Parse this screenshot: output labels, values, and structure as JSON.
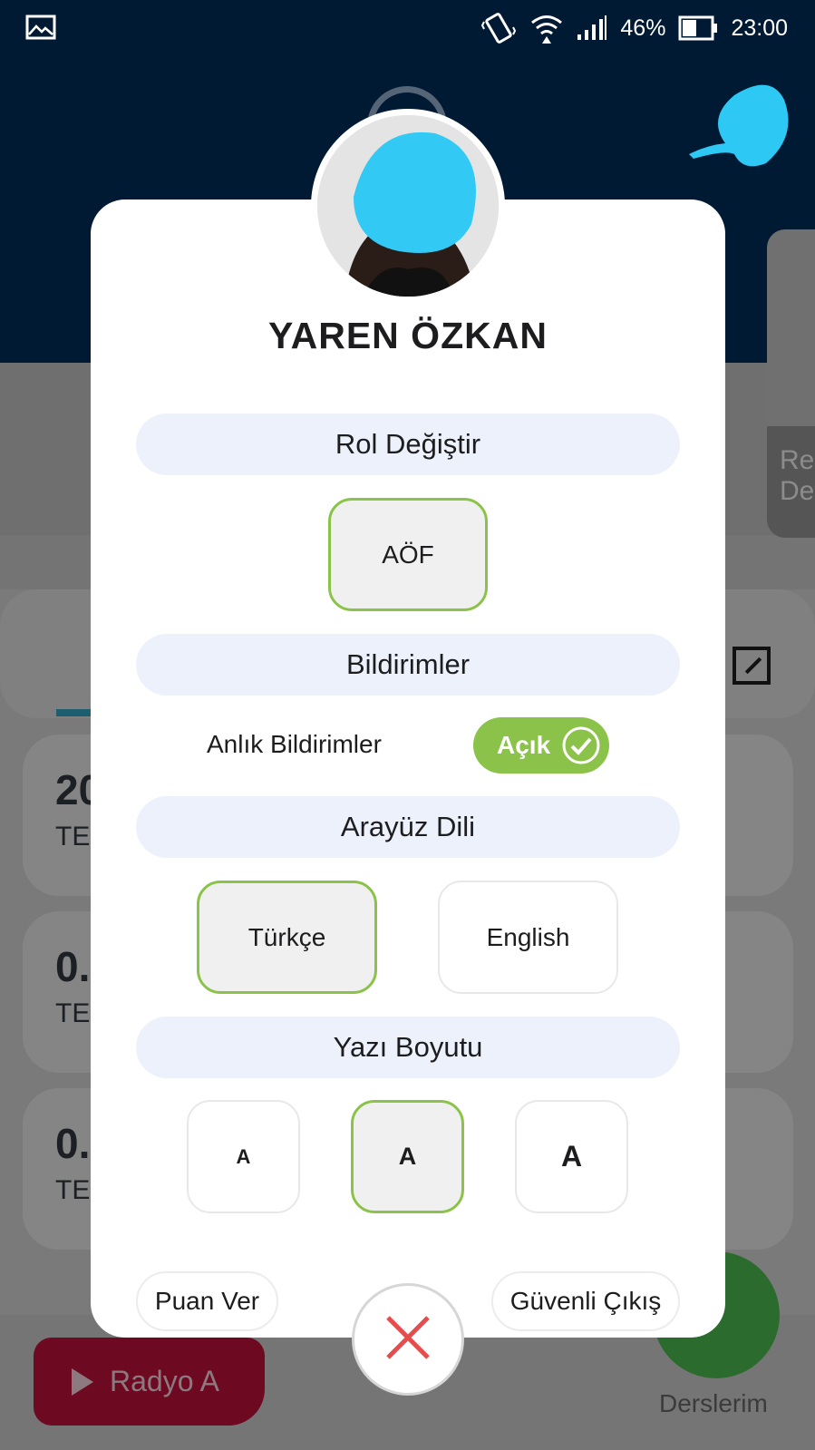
{
  "status_bar": {
    "battery": "46%",
    "time": "23:00",
    "icons": [
      "image-icon",
      "vibrate-icon",
      "wifi-icon",
      "signal-icon",
      "battery-icon"
    ]
  },
  "background": {
    "side_card_text": "Re\nDe",
    "rows": [
      {
        "big": "20",
        "small": "TE"
      },
      {
        "big": "0.",
        "small": "TE"
      },
      {
        "big": "0.",
        "small": "TE"
      }
    ],
    "radio_button": "Radyo A",
    "derslerim_label": "Derslerim"
  },
  "profile": {
    "name": "YAREN ÖZKAN"
  },
  "sections": {
    "role": {
      "title": "Rol Değiştir",
      "options": [
        {
          "label": "AÖF",
          "selected": true
        }
      ]
    },
    "notifications": {
      "title": "Bildirimler",
      "instant_label": "Anlık Bildirimler",
      "toggle_label": "Açık",
      "toggle_on": true
    },
    "language": {
      "title": "Arayüz Dili",
      "options": [
        {
          "label": "Türkçe",
          "selected": true
        },
        {
          "label": "English",
          "selected": false
        }
      ]
    },
    "font_size": {
      "title": "Yazı Boyutu",
      "options": [
        {
          "label": "A",
          "selected": false
        },
        {
          "label": "A",
          "selected": true
        },
        {
          "label": "A",
          "selected": false
        }
      ]
    }
  },
  "footer": {
    "rate_label": "Puan Ver",
    "logout_label": "Güvenli Çıkış"
  },
  "colors": {
    "accent_green": "#8bc34a",
    "header_navy": "#011a33",
    "pill_bg": "#edf1fb",
    "close_red": "#e74c4c"
  }
}
